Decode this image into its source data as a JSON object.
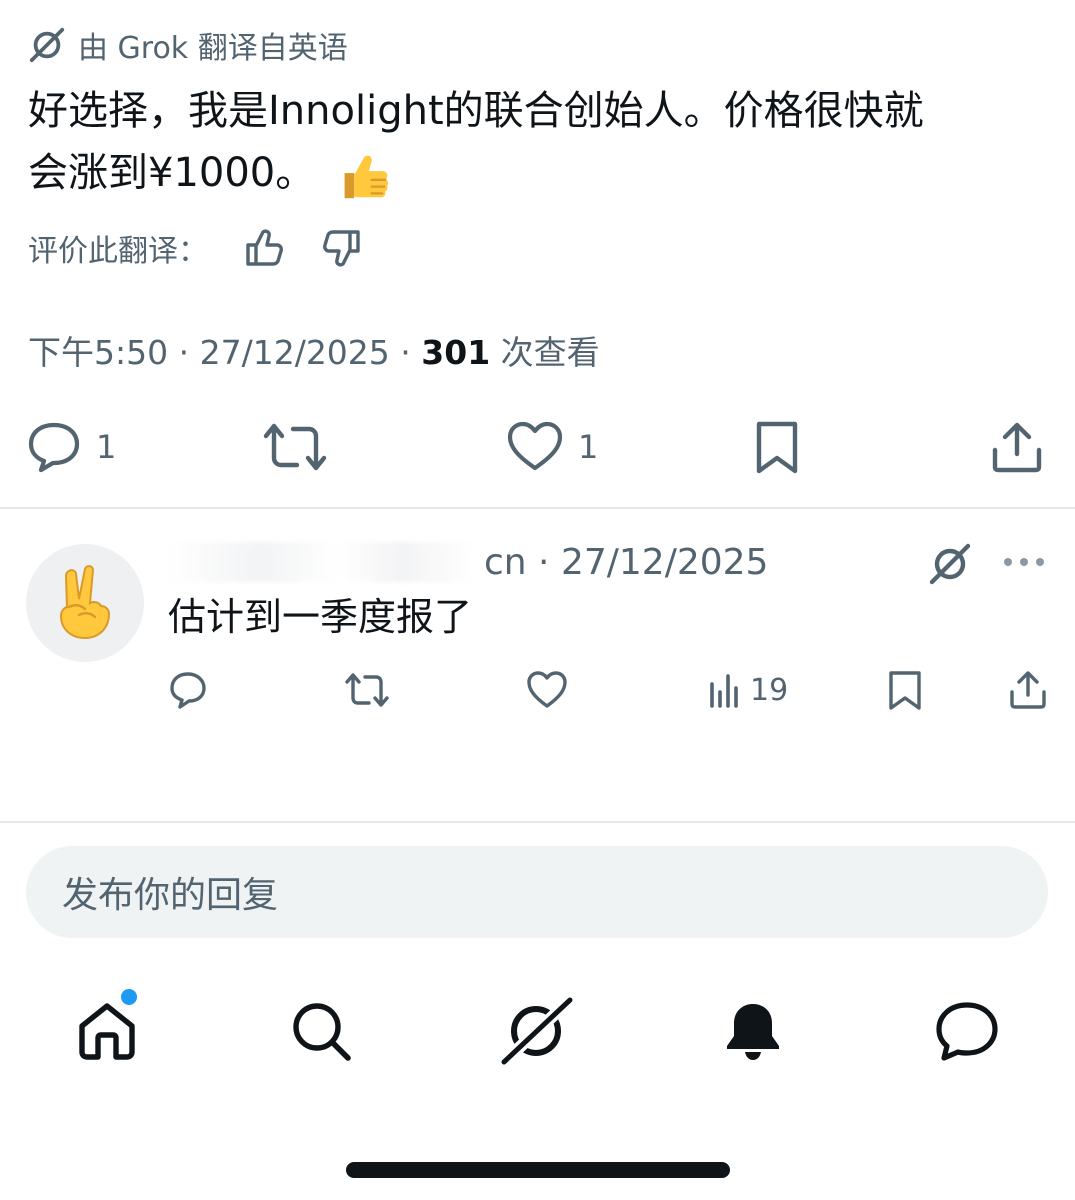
{
  "translation": {
    "translated_by": "由 Grok 翻译自英语",
    "text_line1": "好选择，我是Innolight的联合创始人。价格很快就",
    "text_line2": "会涨到¥1000。",
    "emoji_icon": "thumbs-up-emoji",
    "rate_label": "评价此翻译："
  },
  "tweet_meta": {
    "time": "下午5:50",
    "sep1": " · ",
    "date": "27/12/2025",
    "sep2": " · ",
    "views": "301",
    "views_label": " 次查看"
  },
  "tweet_actions": {
    "reply_count": "1",
    "like_count": "1"
  },
  "reply": {
    "handle_tail": "cn",
    "sep": " · ",
    "date": "27/12/2025",
    "text": "估计到一季度报了",
    "views": "19",
    "avatar_icon": "victory-hand-emoji"
  },
  "reply_box": {
    "placeholder": "发布你的回复"
  },
  "bottom_nav": {
    "items": [
      "home-icon",
      "search-icon",
      "grok-icon",
      "notifications-bell-icon",
      "messages-icon"
    ],
    "home_has_badge": true
  },
  "colors": {
    "text": "#0f1419",
    "muted": "#536471",
    "badge": "#1d9bf0",
    "input_bg": "#eff3f4"
  }
}
